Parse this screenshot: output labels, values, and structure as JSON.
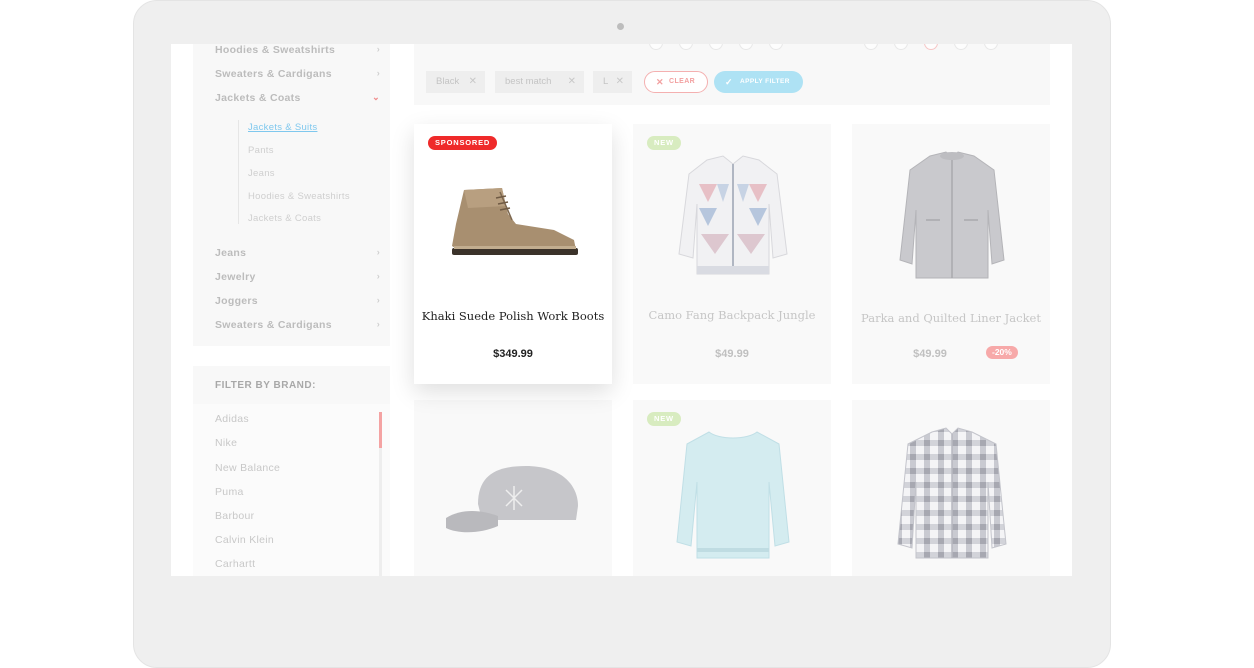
{
  "sidebar": {
    "categories_top": [
      {
        "label": "Hoodies & Sweatshirts"
      },
      {
        "label": "Sweaters & Cardigans"
      },
      {
        "label": "Jackets & Coats"
      }
    ],
    "subcategories": [
      {
        "label": "Jackets & Suits",
        "active": true
      },
      {
        "label": "Pants"
      },
      {
        "label": "Jeans"
      },
      {
        "label": "Hoodies & Sweatshirts"
      },
      {
        "label": "Jackets & Coats"
      }
    ],
    "categories_bottom": [
      {
        "label": "Jeans"
      },
      {
        "label": "Jewelry"
      },
      {
        "label": "Joggers"
      },
      {
        "label": "Sweaters & Cardigans"
      }
    ],
    "brand_filter": {
      "heading": "FILTER BY BRAND:",
      "brands": [
        "Adidas",
        "Nike",
        "New Balance",
        "Puma",
        "Barbour",
        "Calvin Klein",
        "Carhartt"
      ]
    }
  },
  "filters": {
    "chips": [
      {
        "label": "Black"
      },
      {
        "label": "best match"
      },
      {
        "label": "L"
      }
    ],
    "clear_label": "CLEAR",
    "apply_label": "APPLY FILTER"
  },
  "products": [
    {
      "name": "Khaki Suede Polish Work Boots",
      "price": "$349.99",
      "badge": "SPONSORED",
      "icon": "boot-image"
    },
    {
      "name": "Camo Fang Backpack Jungle",
      "price": "$49.99",
      "badge": "NEW",
      "icon": "cardigan-image"
    },
    {
      "name": "Parka and Quilted Liner Jacket",
      "price": "$49.99",
      "discount": "-20%",
      "icon": "parka-image"
    },
    {
      "name": "",
      "price": "",
      "icon": "cap-image"
    },
    {
      "name": "",
      "price": "",
      "badge": "NEW",
      "icon": "sweater-image"
    },
    {
      "name": "",
      "price": "",
      "icon": "plaid-shirt-image"
    }
  ],
  "colors": {
    "accent_red": "#ef2a2a",
    "accent_blue": "#aee2f4",
    "new_green": "#d8ecc0",
    "discount_pink": "#f7a9a9"
  }
}
